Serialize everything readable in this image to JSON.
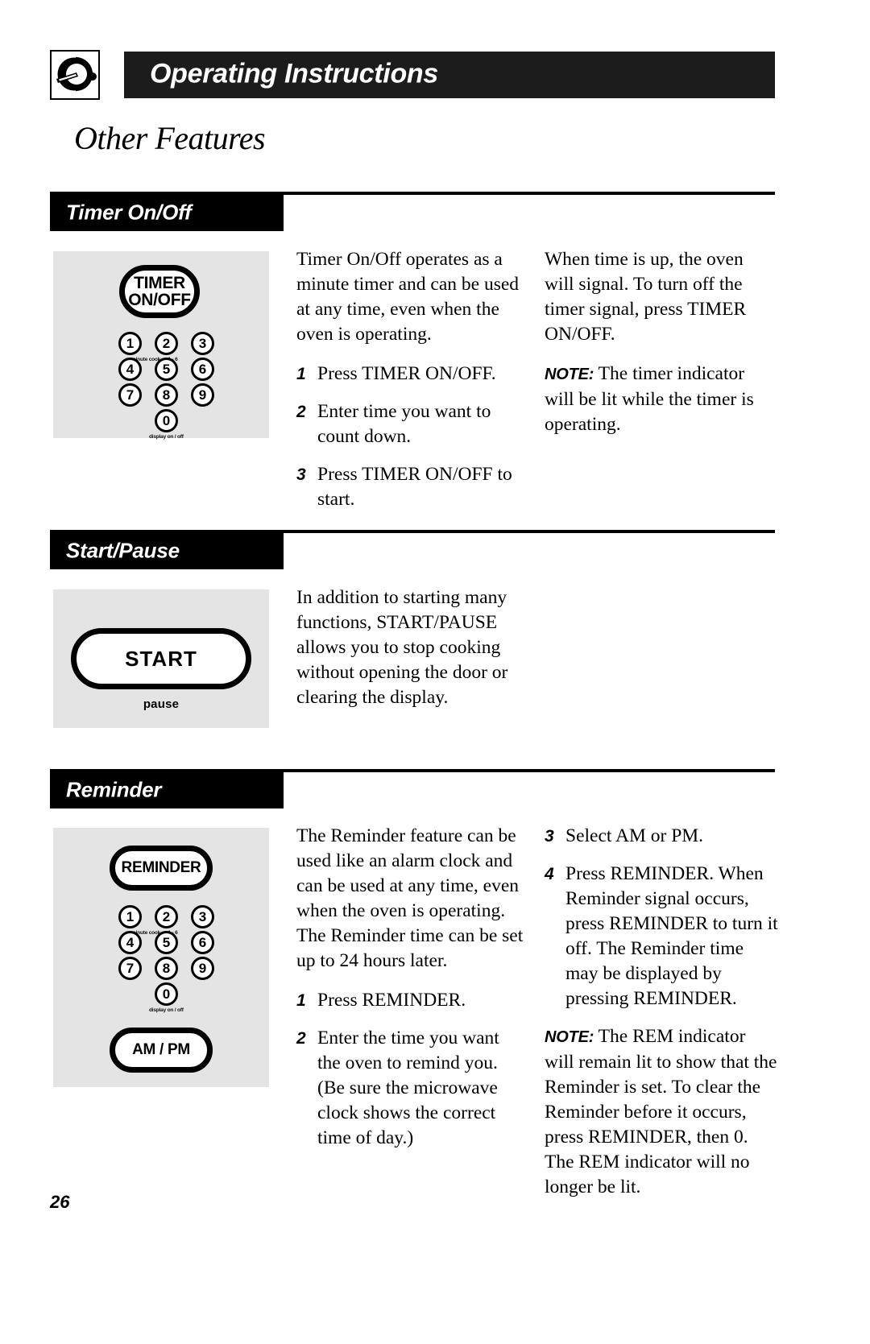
{
  "header": {
    "brand_icon": "microwave-dial-icon",
    "banner_title": "Operating Instructions",
    "page_title": "Other Features"
  },
  "page_number": "26",
  "keypad": {
    "digits": [
      "1",
      "2",
      "3",
      "4",
      "5",
      "6",
      "7",
      "8",
      "9"
    ],
    "zero": "0",
    "minute_cook_label": "minute cook — 1 - 6",
    "display_label": "display on / off"
  },
  "sections": [
    {
      "id": "timer-on-off",
      "tab_label": "Timer On/Off",
      "art": {
        "main_button_line1": "TIMER",
        "main_button_line2": "ON/OFF"
      },
      "column_left": {
        "intro": "Timer On/Off operates as a minute timer and can be used at any time, even when the oven is operating.",
        "steps": [
          {
            "num": "1",
            "text": "Press TIMER ON/OFF."
          },
          {
            "num": "2",
            "text": "Enter time you want to count down."
          },
          {
            "num": "3",
            "text": "Press TIMER ON/OFF to start."
          }
        ]
      },
      "column_right": {
        "paragraph": "When time is up, the oven will signal. To turn off the timer signal, press TIMER ON/OFF.",
        "note_lead": "NOTE:",
        "note_text": " The timer indicator will be lit while the timer is operating."
      }
    },
    {
      "id": "start-pause",
      "tab_label": "Start/Pause",
      "art": {
        "main_button_line1": "START",
        "sub_label": "pause"
      },
      "column_left": {
        "intro": "In addition to starting many functions, START/PAUSE allows you to stop cooking without opening the door or clearing the display."
      }
    },
    {
      "id": "reminder",
      "tab_label": "Reminder",
      "art": {
        "main_button_line1": "REMINDER",
        "ampm_button": "AM / PM"
      },
      "column_left": {
        "intro": "The Reminder feature can be used like an alarm clock and can be used at any time, even when the oven is operating. The Reminder time can be set up to 24 hours later.",
        "steps": [
          {
            "num": "1",
            "text": "Press REMINDER."
          },
          {
            "num": "2",
            "text": "Enter the time you want the oven to remind you. (Be sure the microwave clock shows the correct time of day.)"
          }
        ]
      },
      "column_right": {
        "steps": [
          {
            "num": "3",
            "text": "Select AM or PM."
          },
          {
            "num": "4",
            "text": "Press REMINDER. When Reminder signal occurs, press REMINDER to turn it off. The Reminder time may be displayed by pressing REMINDER."
          }
        ],
        "note_lead": "NOTE:",
        "note_text": " The REM indicator will remain lit to show that the Reminder is set. To clear the Reminder before it occurs, press REMINDER, then 0. The REM indicator will no longer be lit."
      }
    }
  ]
}
